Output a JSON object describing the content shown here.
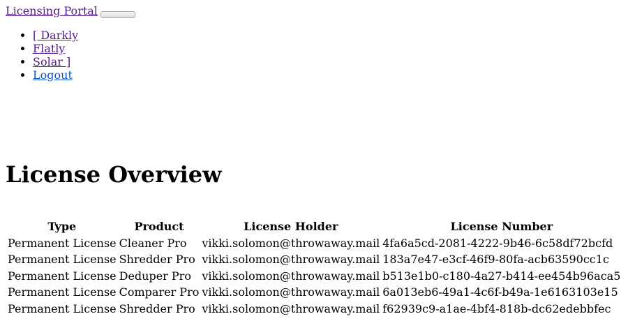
{
  "navbar": {
    "brand": "Licensing Portal",
    "toggler_label": "",
    "items": [
      {
        "label": "[ Darkly"
      },
      {
        "label": "Flatly"
      },
      {
        "label": "Solar ]"
      },
      {
        "label": "Logout"
      }
    ]
  },
  "main": {
    "heading": "License Overview"
  },
  "table": {
    "columns": [
      "Type",
      "Product",
      "License Holder",
      "License Number"
    ],
    "rows": [
      [
        "Permanent License",
        "Cleaner Pro",
        "vikki.solomon@throwaway.mail",
        "4fa6a5cd-2081-4222-9b46-6c58df72bcfd"
      ],
      [
        "Permanent License",
        "Shredder Pro",
        "vikki.solomon@throwaway.mail",
        "183a7e47-e3cf-46f9-80fa-acb63590cc1c"
      ],
      [
        "Permanent License",
        "Deduper Pro",
        "vikki.solomon@throwaway.mail",
        "b513e1b0-c180-4a27-b414-ee454b96aca5"
      ],
      [
        "Permanent License",
        "Comparer Pro",
        "vikki.solomon@throwaway.mail",
        "6a013eb6-49a1-4c6f-b49a-1e6163103e15"
      ],
      [
        "Permanent License",
        "Shredder Pro",
        "vikki.solomon@throwaway.mail",
        "f62939c9-a1ae-4bf4-818b-dc62edebbfec"
      ]
    ]
  }
}
